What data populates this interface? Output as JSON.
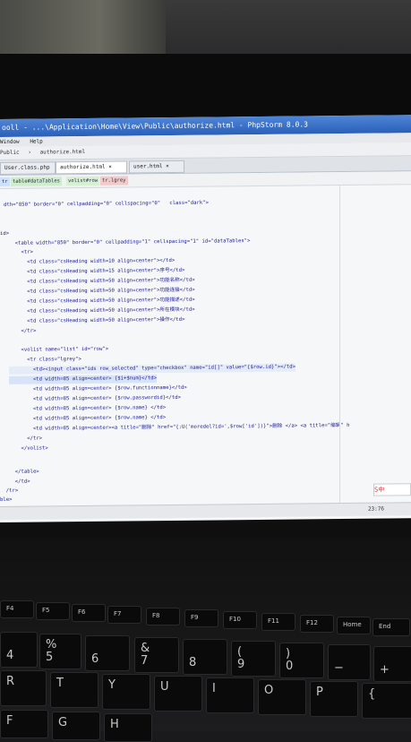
{
  "window": {
    "title": "ooll - ...\\Application\\Home\\View\\Public\\authorize.html - PhpStorm 8.0.3"
  },
  "menu": {
    "items": [
      "Window",
      "Help"
    ]
  },
  "breadcrumb": {
    "items": [
      "Public",
      "authorize.html"
    ]
  },
  "tabs": [
    {
      "label": "User.class.php",
      "active": false
    },
    {
      "label": "authorize.html",
      "active": true
    },
    {
      "label": "user.html",
      "active": false
    }
  ],
  "tag_path": [
    "tr",
    "table#dataTables",
    "volist#row",
    "tr.lgrey"
  ],
  "code": {
    "lines": [
      "dth=\"850\" border=\"0\" cellpadding=\"0\" cellspacing=\"0\"   class=\"dark\">",
      "",
      "",
      "id>",
      "  <table width=\"850\" border=\"0\" cellpadding=\"1\" cellspacing=\"1\" id=\"dataTables\">",
      "    <tr>",
      "      <td class=\"csHeading width=10 align=center\"></td>",
      "      <td class=\"csHeading width=15 align=center\">序号</td>",
      "      <td class=\"csHeading width=50 align=center\">功能名称</td>",
      "      <td class=\"csHeading width=50 align=center\">功能连接</td>",
      "      <td class=\"csHeading width=50 align=center\">功能描述</td>",
      "      <td class=\"csHeading width=50 align=center\">所在模块</td>",
      "      <td class=\"csHeading width=50 align=center\">操作</td>",
      "    </tr>",
      "",
      "    <volist name=\"list\" id=\"row\">",
      "      <tr class=\"lgrey\">",
      "        <td><input class=\"ids row_selected\" type=\"checkbox\" name=\"id[]\" value=\"{$row.id}\"></td>",
      "        <td width=85 align=center> {$i+$num}</td>",
      "        <td width=85 align=center> {$row.functionname}</td>",
      "        <td width=85 align=center> {$row.passwordid}</td>",
      "        <td width=85 align=center> {$row.name} </td>",
      "        <td width=85 align=center> {$row.name} </td>",
      "        <td width=85 align=center><a title=\"删除\" href=\"{:U('moredel?id=',$row['id'])}\">删除 </a> <a title=\"编辑\" h",
      "      </tr>",
      "    </volist>",
      "",
      "",
      "  </table>",
      "  </td>",
      "  /tr>",
      "ble>"
    ]
  },
  "ime_indicator": "S中",
  "status": {
    "position": "23:76"
  },
  "keyboard": {
    "function_row": [
      "F4",
      "F5",
      "F6",
      "F7",
      "F8",
      "F9",
      "F10",
      "F11",
      "F12",
      "Home",
      "End"
    ],
    "number_row": [
      "4",
      "5",
      "6",
      "7",
      "8",
      "9",
      "0",
      "−",
      "+"
    ],
    "number_row_shift": [
      "$",
      "%",
      "^",
      "&",
      "*",
      "(",
      ")",
      "_",
      "="
    ],
    "letter_row": [
      "R",
      "T",
      "Y",
      "U",
      "I",
      "O",
      "P",
      "{"
    ],
    "bottom_row": [
      "F",
      "G",
      "H"
    ]
  }
}
